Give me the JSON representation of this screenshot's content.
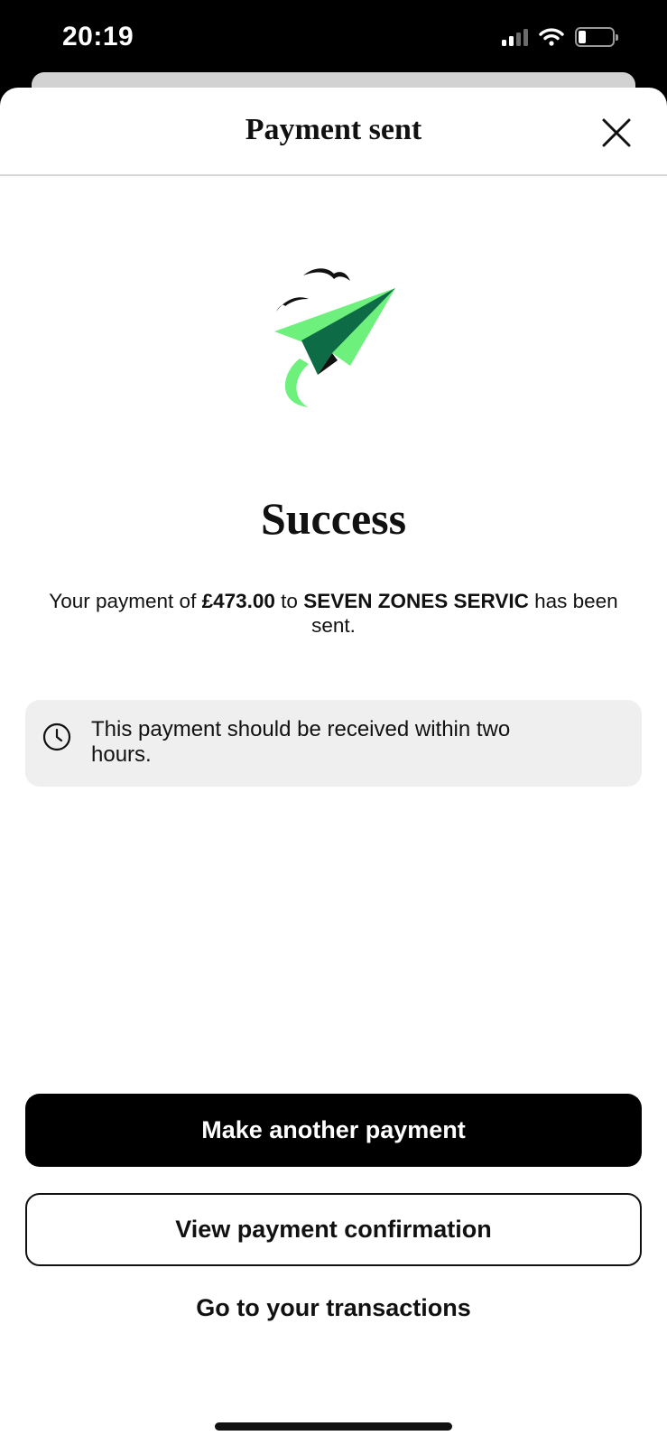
{
  "status_bar": {
    "time": "20:19"
  },
  "header": {
    "title": "Payment sent",
    "close_icon": "close-icon"
  },
  "illustration": {
    "icon": "paper-plane-icon",
    "colors": {
      "plane_light": "#6df07c",
      "plane_dark": "#0d6b45",
      "birds": "#111111"
    }
  },
  "result": {
    "title": "Success",
    "message_prefix": "Your payment of ",
    "amount": "£473.00",
    "message_middle": " to ",
    "payee": "SEVEN ZONES SERVIC",
    "message_suffix": " has been sent."
  },
  "info": {
    "icon": "clock-icon",
    "text": "This payment should be received within two hours."
  },
  "actions": {
    "primary_label": "Make another payment",
    "secondary_label": "View payment confirmation",
    "link_label": "Go to your transactions"
  }
}
